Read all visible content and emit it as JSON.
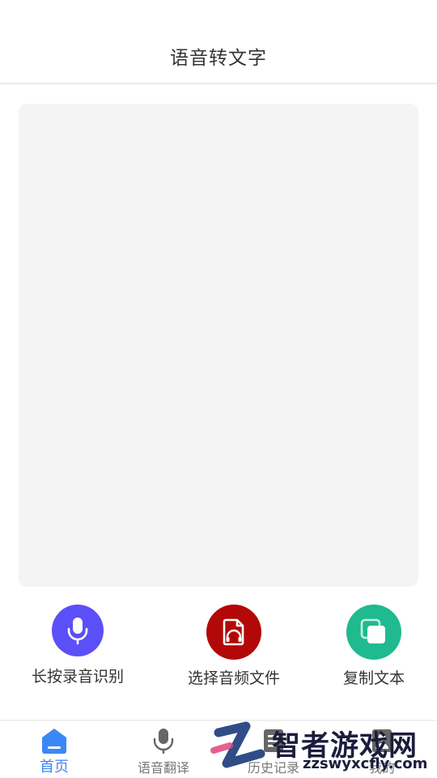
{
  "header": {
    "title": "语音转文字"
  },
  "text_area": {
    "content": ""
  },
  "actions": [
    {
      "label": "长按录音识别",
      "icon": "microphone-icon",
      "color": "#5b4ff7"
    },
    {
      "label": "选择音频文件",
      "icon": "audio-file-icon",
      "color": "#b30808"
    },
    {
      "label": "复制文本",
      "icon": "copy-icon",
      "color": "#1fba8f"
    }
  ],
  "tabbar": {
    "items": [
      {
        "label": "首页",
        "icon": "home-icon",
        "active": true
      },
      {
        "label": "语音翻译",
        "icon": "microphone-icon",
        "active": false
      },
      {
        "label": "历史记录",
        "icon": "history-icon",
        "active": false
      },
      {
        "label": "我的",
        "icon": "profile-icon",
        "active": false
      }
    ]
  },
  "watermark": {
    "text": "智者游戏网",
    "url": "zzswyxcfly.com"
  },
  "colors": {
    "active_tab": "#3c87f6",
    "inactive_tab": "#777777",
    "text_area_bg": "#f4f4f4"
  }
}
